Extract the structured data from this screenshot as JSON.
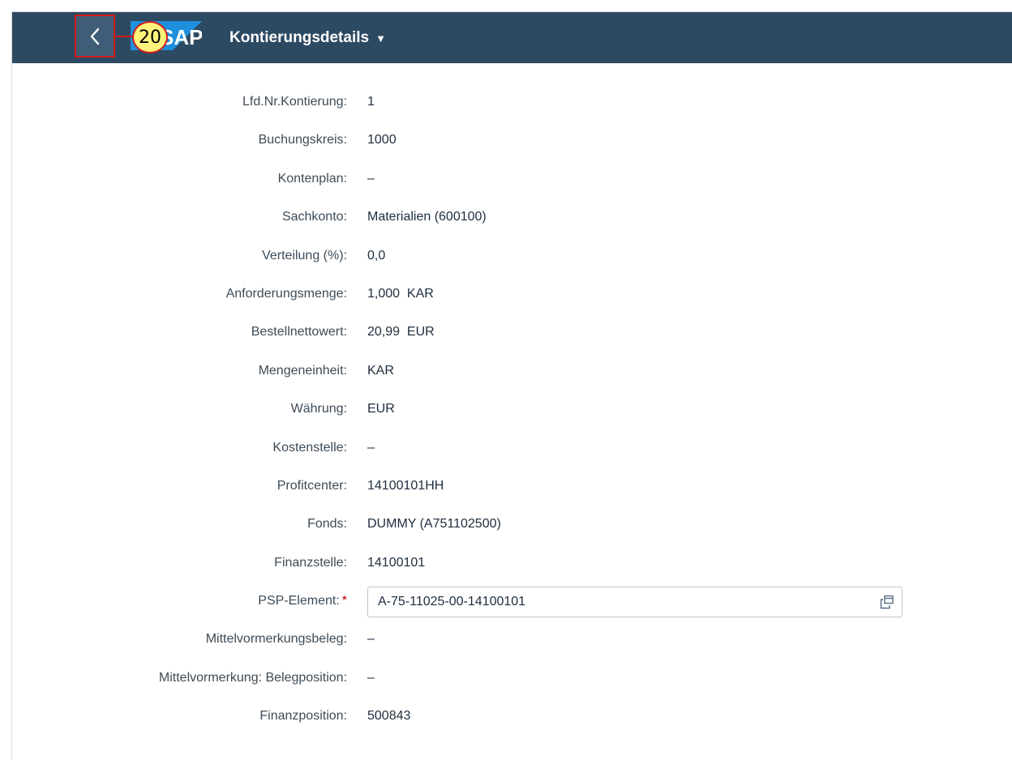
{
  "header": {
    "back_icon": "chevron-left-icon",
    "logo": "SAP",
    "step_badge": "20",
    "title": "Kontierungsdetails",
    "title_caret_icon": "caret-down-icon",
    "colors": {
      "shell_background": "#2d4a63",
      "highlight": "#d11a1a",
      "badge_fill": "#fef37a",
      "logo_blue": "#1e8fdc"
    }
  },
  "fields": [
    {
      "label": "Lfd.Nr.Kontierung:",
      "value": "1"
    },
    {
      "label": "Buchungskreis:",
      "value": "1000"
    },
    {
      "label": "Kontenplan:",
      "value": "–"
    },
    {
      "label": "Sachkonto:",
      "value": "Materialien (600100)"
    },
    {
      "label": "Verteilung (%):",
      "value": "0,0"
    },
    {
      "label": "Anforderungsmenge:",
      "value": "1,000  KAR"
    },
    {
      "label": "Bestellnettowert:",
      "value": "20,99  EUR"
    },
    {
      "label": "Mengeneinheit:",
      "value": "KAR"
    },
    {
      "label": "Währung:",
      "value": "EUR"
    },
    {
      "label": "Kostenstelle:",
      "value": "–"
    },
    {
      "label": "Profitcenter:",
      "value": "14100101HH"
    },
    {
      "label": "Fonds:",
      "value": "DUMMY (A751102500)"
    },
    {
      "label": "Finanzstelle:",
      "value": "14100101"
    },
    {
      "label": "PSP-Element:",
      "required_marker": "*",
      "input_value": "A-75-11025-00-14100101",
      "value_help_icon": "value-help-icon"
    },
    {
      "label": "Mittelvormerkungsbeleg:",
      "value": "–"
    },
    {
      "label": "Mittelvormerkung: Belegposition:",
      "value": "–"
    },
    {
      "label": "Finanzposition:",
      "value": "500843"
    }
  ]
}
